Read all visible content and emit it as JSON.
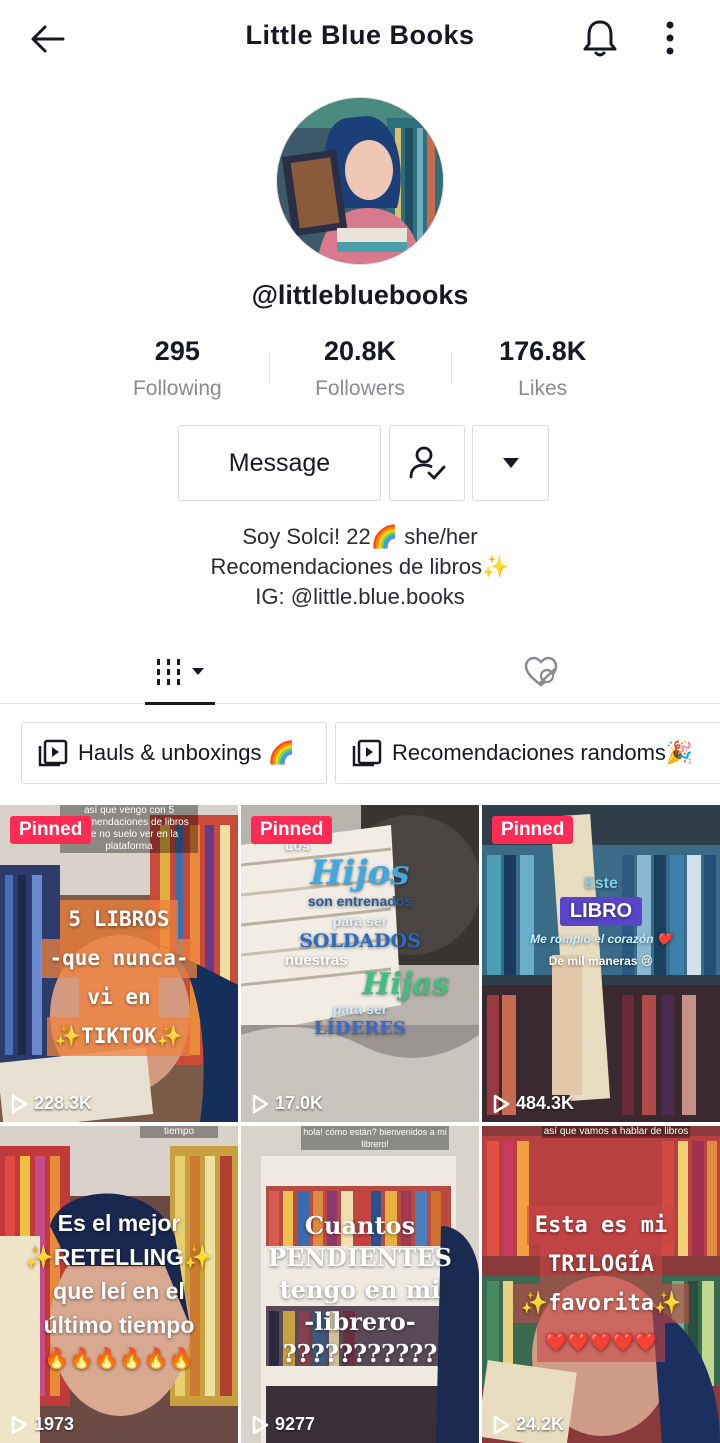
{
  "header": {
    "title": "Little Blue Books"
  },
  "profile": {
    "handle": "@littlebluebooks",
    "stats": [
      {
        "value": "295",
        "label": "Following"
      },
      {
        "value": "20.8K",
        "label": "Followers"
      },
      {
        "value": "176.8K",
        "label": "Likes"
      }
    ],
    "message_label": "Message",
    "bio": [
      "Soy Solci! 22🌈 she/her",
      "Recomendaciones de libros✨",
      "IG: @little.blue.books"
    ]
  },
  "playlists": [
    {
      "label": "Hauls & unboxings 🌈"
    },
    {
      "label": "Recomendaciones randoms🎉"
    }
  ],
  "videos": [
    {
      "pinned": "Pinned",
      "views": "228.3K",
      "top_text": "así que vengo con 5 recomendaciones de libros que no suelo ver en la plataforma",
      "caption": [
        "5 LIBROS",
        "-que nunca-",
        "vi en",
        "✨TIKTOK✨"
      ]
    },
    {
      "pinned": "Pinned",
      "views": "17.0K",
      "caption": [
        "Los",
        "Hijos",
        "son entrenados",
        "para ser",
        "SOLDADOS",
        "nuestras",
        "Hijas",
        "para ser",
        "LÍDERES"
      ]
    },
    {
      "pinned": "Pinned",
      "views": "484.3K",
      "caption": [
        "Este",
        "LIBRO",
        "Me rompió el corazón ❤️",
        "De mil maneras 😢"
      ]
    },
    {
      "views": "1973",
      "top_text": "tiempo",
      "caption": [
        "Es el mejor",
        "✨RETELLING✨",
        "que leí en el",
        "último tiempo",
        "🔥🔥🔥🔥🔥🔥"
      ]
    },
    {
      "views": "9277",
      "top_text": "hola! cómo están? bienvenidos a mi librero!",
      "caption": [
        "Cuantos",
        "PENDIENTES",
        "tengo en mi",
        "-librero-",
        "???????????"
      ]
    },
    {
      "views": "24.2K",
      "top_text": "así que vamos a hablar de libros",
      "caption": [
        "Esta es mi",
        "TRILOGÍA",
        "✨favorita✨",
        "❤️❤️❤️❤️❤️"
      ]
    }
  ],
  "colors": {
    "pinned": "#fe2c55",
    "text": "#161823",
    "muted": "#8a8b91"
  }
}
